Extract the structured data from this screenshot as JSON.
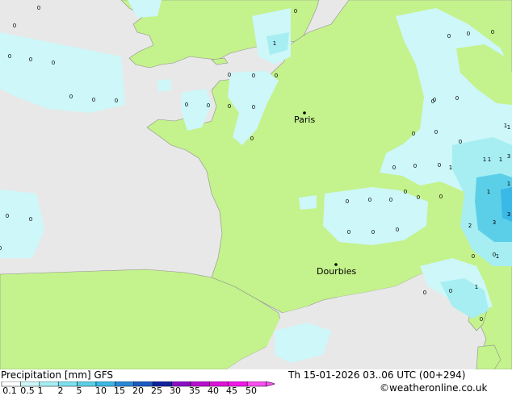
{
  "title_left": "Precipitation [mm]",
  "model": "GFS",
  "datetime": "Th 15-01-2026 03..06 UTC (00+294)",
  "credit": "©weatheronline.co.uk",
  "legend": {
    "ticks": [
      "0.1",
      "0.5",
      "1",
      "2",
      "5",
      "10",
      "15",
      "20",
      "25",
      "30",
      "35",
      "40",
      "45",
      "50"
    ],
    "colors": [
      "#ffffff",
      "#cdf7f9",
      "#a6eef2",
      "#7fe0ee",
      "#5ccfe8",
      "#3ab8e6",
      "#2c88d6",
      "#1c5bc2",
      "#10229e",
      "#8a0fc4",
      "#b90fd0",
      "#df12d8",
      "#f218e8",
      "#f94ff0"
    ]
  },
  "cities": [
    {
      "name": "Paris"
    },
    {
      "name": "Dourbies"
    }
  ],
  "values": [
    "0",
    "0",
    "0",
    "0",
    "0",
    "0",
    "0",
    "0",
    "0",
    "0",
    "0",
    "0",
    "0",
    "0",
    "0",
    "0",
    "0",
    "0",
    "0",
    "0",
    "0",
    "0",
    "0",
    "0",
    "0",
    "0",
    "0",
    "0",
    "0",
    "0",
    "0",
    "0",
    "0",
    "0",
    "0",
    "0",
    "0",
    "0",
    "0",
    "0",
    "0",
    "0",
    "0",
    "0",
    "1",
    "1",
    "1",
    "1",
    "1",
    "3",
    "3",
    "2",
    "3",
    "1",
    "1",
    "1",
    "1",
    "1",
    "1",
    "0",
    "0"
  ],
  "colors": {
    "sea": "#e8e8e8",
    "land": "#c4f28c",
    "precip_light": "#cdf7f9",
    "precip_mid": "#a6eef2",
    "precip_heavy": "#5ccfe8",
    "border": "#909090"
  }
}
